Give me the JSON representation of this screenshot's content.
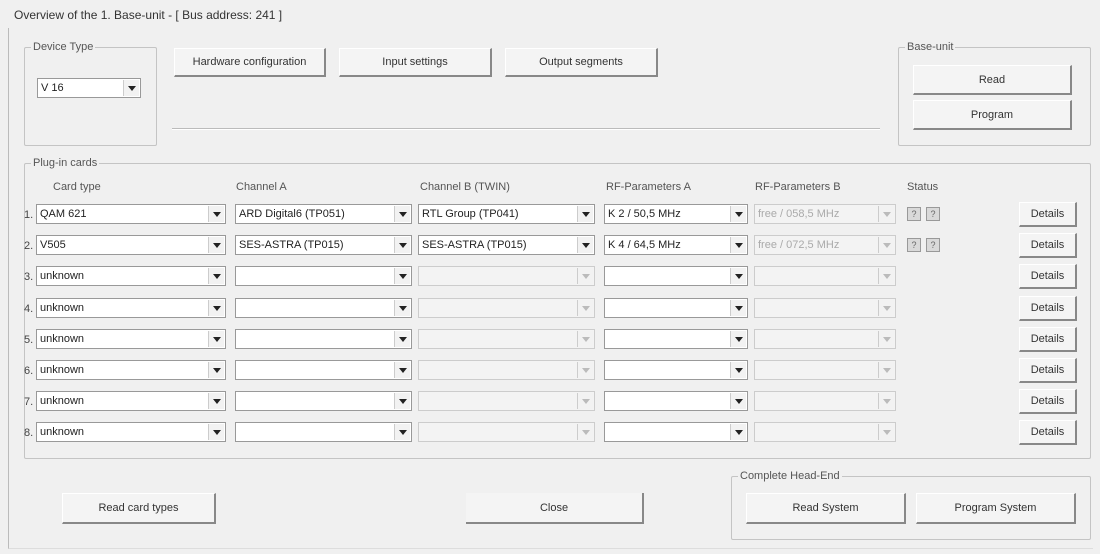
{
  "window_title": "Overview of the 1. Base-unit - [ Bus address: 241 ]",
  "device_type": {
    "legend": "Device Type",
    "value": "V 16"
  },
  "toolbar": {
    "hardware_configuration": "Hardware configuration",
    "input_settings": "Input settings",
    "output_segments": "Output segments"
  },
  "base_unit": {
    "legend": "Base-unit",
    "read": "Read",
    "program": "Program"
  },
  "plugin": {
    "legend": "Plug-in cards",
    "headers": {
      "card_type": "Card type",
      "channel_a": "Channel A",
      "channel_b": "Channel B (TWIN)",
      "rf_a": "RF-Parameters A",
      "rf_b": "RF-Parameters B",
      "status": "Status"
    },
    "rows": [
      {
        "num": "1.",
        "card": "QAM 621",
        "ch_a": "ARD Digital6 (TP051)",
        "ch_b": "RTL Group (TP041)",
        "rf_a": "K 2 / 50,5 MHz",
        "rf_b": "free / 058,5 MHz",
        "status": [
          "?",
          "?"
        ],
        "details": "Details"
      },
      {
        "num": "2.",
        "card": "V505",
        "ch_a": "SES-ASTRA (TP015)",
        "ch_b": "SES-ASTRA (TP015)",
        "rf_a": "K 4 / 64,5 MHz",
        "rf_b": "free / 072,5 MHz",
        "status": [
          "?",
          "?"
        ],
        "details": "Details"
      },
      {
        "num": "3.",
        "card": "unknown",
        "ch_a": "",
        "ch_b": "",
        "rf_a": "",
        "rf_b": "",
        "details": "Details"
      },
      {
        "num": "4.",
        "card": "unknown",
        "ch_a": "",
        "ch_b": "",
        "rf_a": "",
        "rf_b": "",
        "details": "Details"
      },
      {
        "num": "5.",
        "card": "unknown",
        "ch_a": "",
        "ch_b": "",
        "rf_a": "",
        "rf_b": "",
        "details": "Details"
      },
      {
        "num": "6.",
        "card": "unknown",
        "ch_a": "",
        "ch_b": "",
        "rf_a": "",
        "rf_b": "",
        "details": "Details"
      },
      {
        "num": "7.",
        "card": "unknown",
        "ch_a": "",
        "ch_b": "",
        "rf_a": "",
        "rf_b": "",
        "details": "Details"
      },
      {
        "num": "8.",
        "card": "unknown",
        "ch_a": "",
        "ch_b": "",
        "rf_a": "",
        "rf_b": "",
        "details": "Details"
      }
    ]
  },
  "footer": {
    "read_card_types": "Read card types",
    "close": "Close",
    "headend_legend": "Complete Head-End",
    "read_system": "Read System",
    "program_system": "Program System"
  }
}
